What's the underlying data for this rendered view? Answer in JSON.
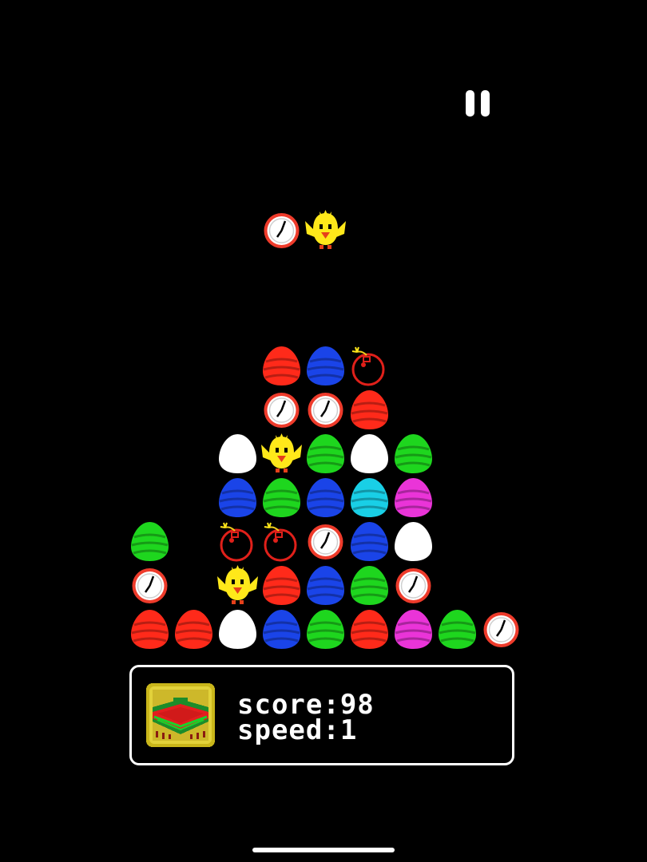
{
  "game": {
    "colors": {
      "red": "#ff2a1a",
      "blue": "#1a44e8",
      "green": "#1ed61e",
      "white": "#ffffff",
      "cyan": "#19cfe6",
      "magenta": "#ea34d8",
      "chick": "#ffe81a",
      "clock_rim": "#ee3b2b",
      "bomb": "#e0201a"
    },
    "falling_piece": [
      "clock",
      "chick"
    ],
    "board": [
      [
        null,
        null,
        null,
        "red",
        "blue",
        "bomb",
        null,
        null,
        null
      ],
      [
        null,
        null,
        null,
        "clock",
        "clock",
        "red",
        null,
        null,
        null
      ],
      [
        null,
        null,
        "white",
        "chick",
        "green",
        "white",
        "green",
        null,
        null
      ],
      [
        null,
        null,
        "blue",
        "green",
        "blue",
        "cyan",
        "magenta",
        null,
        null
      ],
      [
        "green",
        null,
        "bomb",
        "bomb",
        "clock",
        "blue",
        "white",
        null,
        null
      ],
      [
        "clock",
        null,
        "chick",
        "red",
        "blue",
        "green",
        "clock",
        null,
        null
      ],
      [
        "red",
        "red",
        "white",
        "blue",
        "green",
        "red",
        "magenta",
        "green",
        "clock"
      ]
    ]
  },
  "controls": {
    "pause_icon": "pause-icon"
  },
  "status": {
    "score_text": "score:98",
    "speed_text": "speed:1",
    "level_icon": "poncho-icon"
  }
}
